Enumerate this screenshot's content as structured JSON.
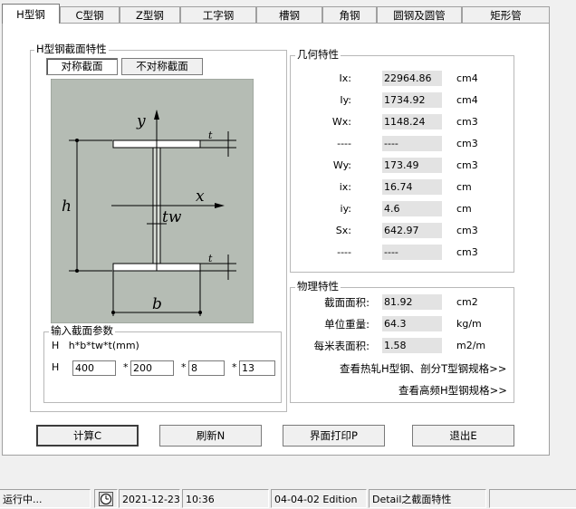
{
  "tabs": [
    "H型钢",
    "C型钢",
    "Z型钢",
    "工字钢",
    "槽钢",
    "角钢",
    "圆钢及圆管",
    "矩形管"
  ],
  "section_group_title": "H型钢截面特性",
  "symmetry": {
    "sym_label": "对称截面",
    "asym_label": "不对称截面"
  },
  "diagram": {
    "y": "y",
    "x": "x",
    "h": "h",
    "b": "b",
    "tw": "tw",
    "t": "t"
  },
  "geometry": {
    "title": "几何特性",
    "rows": [
      {
        "label": "Ix:",
        "value": "22964.86",
        "unit": "cm4"
      },
      {
        "label": "Iy:",
        "value": "1734.92",
        "unit": "cm4"
      },
      {
        "label": "Wx:",
        "value": "1148.24",
        "unit": "cm3"
      },
      {
        "label": "----",
        "value": "----",
        "unit": "cm3"
      },
      {
        "label": "Wy:",
        "value": "173.49",
        "unit": "cm3"
      },
      {
        "label": "ix:",
        "value": "16.74",
        "unit": "cm"
      },
      {
        "label": "iy:",
        "value": "4.6",
        "unit": "cm"
      },
      {
        "label": "Sx:",
        "value": "642.97",
        "unit": "cm3"
      },
      {
        "label": "----",
        "value": "----",
        "unit": "cm3"
      }
    ]
  },
  "physical": {
    "title": "物理特性",
    "rows": [
      {
        "label": "截面面积:",
        "value": "81.92",
        "unit": "cm2"
      },
      {
        "label": "单位重量:",
        "value": "64.3",
        "unit": "kg/m"
      },
      {
        "label": "每米表面积:",
        "value": "1.58",
        "unit": "m2/m"
      }
    ],
    "link1": "查看热轧H型钢、剖分T型钢规格>>",
    "link2": "查看高频H型钢规格>>"
  },
  "params": {
    "title": "输入截面参数",
    "formula": "H   h*b*tw*t(mm)",
    "prefix": "H",
    "sep": "*",
    "h": "400",
    "b": "200",
    "tw": "8",
    "t": "13"
  },
  "buttons": {
    "calc": "计算C",
    "refresh": "刷新N",
    "print": "界面打印P",
    "exit": "退出E"
  },
  "statusbar": {
    "running": "运行中...",
    "date": "2021-12-23",
    "time": "10:36",
    "edition": "04-04-02 Edition",
    "detail": "Detail之截面特性"
  }
}
